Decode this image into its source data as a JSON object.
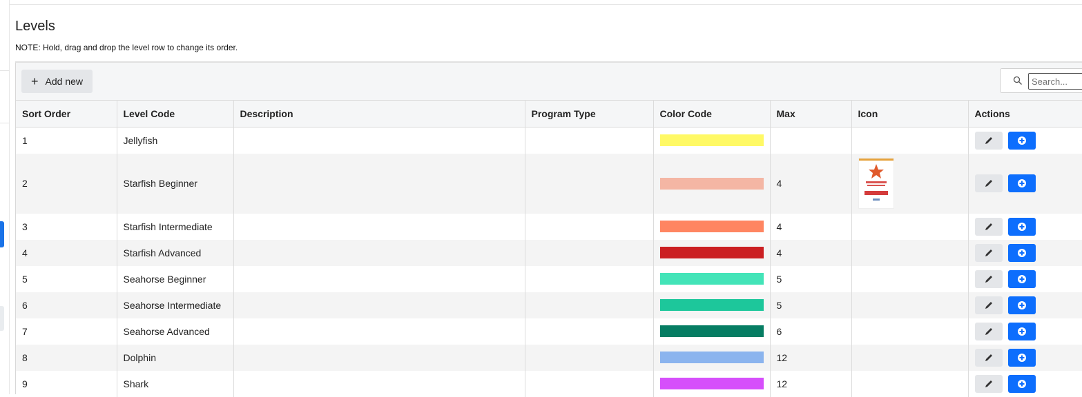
{
  "page": {
    "title": "Levels",
    "note": "NOTE: Hold, drag and drop the level row to change its order."
  },
  "toolbar": {
    "add_label": "Add new",
    "search_placeholder": "Search..."
  },
  "table": {
    "headers": [
      "Sort Order",
      "Level Code",
      "Description",
      "Program Type",
      "Color Code",
      "Max",
      "Icon",
      "Actions"
    ],
    "rows": [
      {
        "sort": "1",
        "code": "Jellyfish",
        "description": "",
        "program_type": "",
        "color": "#fff965",
        "max": "",
        "icon": ""
      },
      {
        "sort": "2",
        "code": "Starfish Beginner",
        "description": "",
        "program_type": "",
        "color": "#f4b6a4",
        "max": "4",
        "icon": "starfish-certificate-image"
      },
      {
        "sort": "3",
        "code": "Starfish Intermediate",
        "description": "",
        "program_type": "",
        "color": "#ff8561",
        "max": "4",
        "icon": ""
      },
      {
        "sort": "4",
        "code": "Starfish Advanced",
        "description": "",
        "program_type": "",
        "color": "#cb1f22",
        "max": "4",
        "icon": ""
      },
      {
        "sort": "5",
        "code": "Seahorse Beginner",
        "description": "",
        "program_type": "",
        "color": "#43e4b8",
        "max": "5",
        "icon": ""
      },
      {
        "sort": "6",
        "code": "Seahorse Intermediate",
        "description": "",
        "program_type": "",
        "color": "#1dc79b",
        "max": "5",
        "icon": ""
      },
      {
        "sort": "7",
        "code": "Seahorse Advanced",
        "description": "",
        "program_type": "",
        "color": "#067d63",
        "max": "6",
        "icon": ""
      },
      {
        "sort": "8",
        "code": "Dolphin",
        "description": "",
        "program_type": "",
        "color": "#8bb4ee",
        "max": "12",
        "icon": ""
      },
      {
        "sort": "9",
        "code": "Shark",
        "description": "",
        "program_type": "",
        "color": "#d64ffb",
        "max": "12",
        "icon": ""
      }
    ]
  },
  "colors": {
    "primary": "#0d6efd",
    "secondary_button": "#e4e6e9"
  },
  "icons": {
    "add": "plus-icon",
    "search": "search-icon",
    "edit": "pencil-icon",
    "add_row": "plus-circle-icon"
  }
}
